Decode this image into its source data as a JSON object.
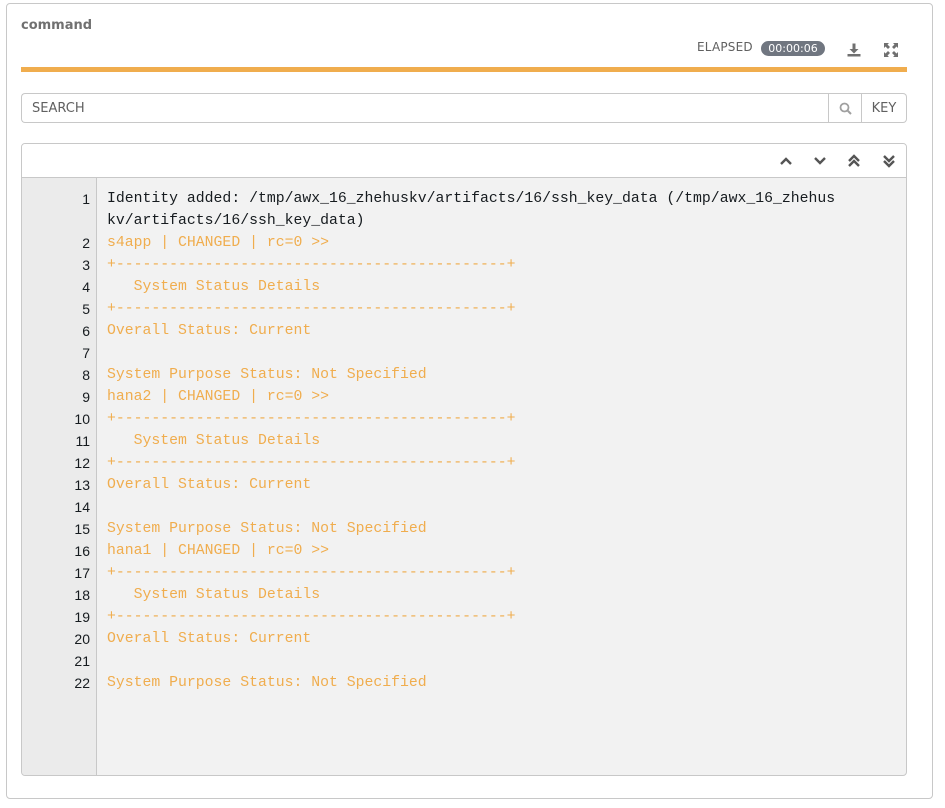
{
  "header": {
    "title": "command",
    "elapsed_label": "ELAPSED",
    "elapsed_value": "00:00:06",
    "download_icon": "download-icon",
    "expand_icon": "expand-icon"
  },
  "progress": {
    "percent": 100,
    "color": "#f0ad4e"
  },
  "search": {
    "placeholder": "SEARCH",
    "value": "",
    "search_icon": "search-icon",
    "key_label": "KEY"
  },
  "output_toolbar": {
    "icons": [
      "chevron-up-icon",
      "chevron-down-icon",
      "double-chevron-up-icon",
      "double-chevron-down-icon"
    ]
  },
  "colors": {
    "changed": "#f0ad4e",
    "default": "#161b1f"
  },
  "output_lines": [
    {
      "n": "1",
      "text": "Identity added: /tmp/awx_16_zhehuskv/artifacts/16/ssh_key_data (/tmp/awx_16_zhehuskv/artifacts/16/ssh_key_data)",
      "style": "dark"
    },
    {
      "n": "2",
      "text": "s4app | CHANGED | rc=0 >>",
      "style": "warn"
    },
    {
      "n": "3",
      "text": "+--------------------------------------------+",
      "style": "warn"
    },
    {
      "n": "4",
      "text": "   System Status Details",
      "style": "warn"
    },
    {
      "n": "5",
      "text": "+--------------------------------------------+",
      "style": "warn"
    },
    {
      "n": "6",
      "text": "Overall Status: Current",
      "style": "warn"
    },
    {
      "n": "7",
      "text": "",
      "style": "warn"
    },
    {
      "n": "8",
      "text": "System Purpose Status: Not Specified",
      "style": "warn"
    },
    {
      "n": "9",
      "text": "hana2 | CHANGED | rc=0 >>",
      "style": "warn"
    },
    {
      "n": "10",
      "text": "+--------------------------------------------+",
      "style": "warn"
    },
    {
      "n": "11",
      "text": "   System Status Details",
      "style": "warn"
    },
    {
      "n": "12",
      "text": "+--------------------------------------------+",
      "style": "warn"
    },
    {
      "n": "13",
      "text": "Overall Status: Current",
      "style": "warn"
    },
    {
      "n": "14",
      "text": "",
      "style": "warn"
    },
    {
      "n": "15",
      "text": "System Purpose Status: Not Specified",
      "style": "warn"
    },
    {
      "n": "16",
      "text": "hana1 | CHANGED | rc=0 >>",
      "style": "warn"
    },
    {
      "n": "17",
      "text": "+--------------------------------------------+",
      "style": "warn"
    },
    {
      "n": "18",
      "text": "   System Status Details",
      "style": "warn"
    },
    {
      "n": "19",
      "text": "+--------------------------------------------+",
      "style": "warn"
    },
    {
      "n": "20",
      "text": "Overall Status: Current",
      "style": "warn"
    },
    {
      "n": "21",
      "text": "",
      "style": "warn"
    },
    {
      "n": "22",
      "text": "System Purpose Status: Not Specified",
      "style": "warn"
    }
  ]
}
